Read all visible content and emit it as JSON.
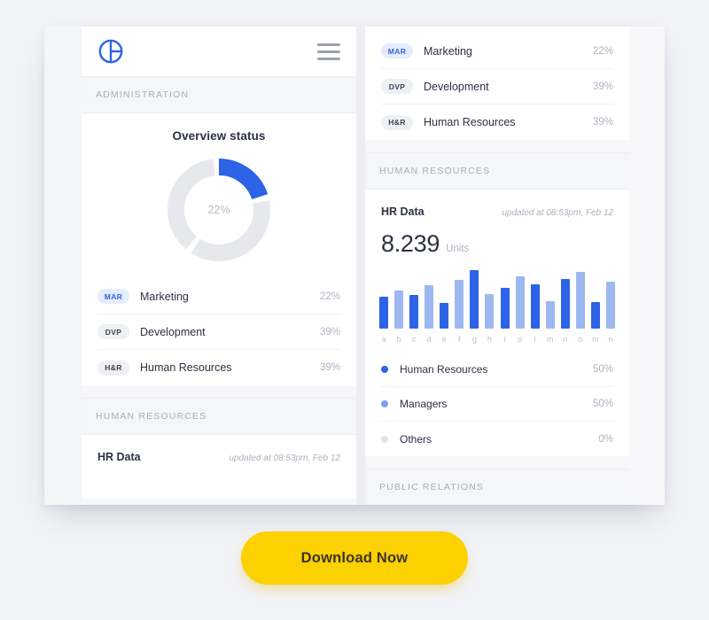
{
  "theme": {
    "page_background": "#f2f3f7",
    "card_background": "#ffffff",
    "band_background": "#f5f6f8",
    "accent_blue": "#2d63e6",
    "accent_blue_light": "#9db8f0",
    "muted_grey": "#e6e8ec",
    "cta_yellow": "#fdd000",
    "text_primary": "#2b3142",
    "text_muted": "#b0b4c0"
  },
  "appbar": {
    "logo_icon": "circle-quadrant-logo-icon",
    "menu_icon": "hamburger-menu-icon"
  },
  "left_panel": {
    "section_admin_label": "ADMINISTRATION",
    "overview": {
      "title": "Overview status",
      "center_value": "22%"
    },
    "departments": [
      {
        "code": "MAR",
        "label": "Marketing",
        "value": "22%",
        "badge_style": "accent"
      },
      {
        "code": "DVP",
        "label": "Development",
        "value": "39%",
        "badge_style": "mute"
      },
      {
        "code": "H&R",
        "label": "Human Resources",
        "value": "39%",
        "badge_style": "mute"
      }
    ],
    "section_hr_label": "HUMAN RESOURCES",
    "hr": {
      "title": "HR Data",
      "updated": "updated at 08:53pm, Feb 12"
    }
  },
  "right_panel": {
    "departments": [
      {
        "code": "MAR",
        "label": "Marketing",
        "value": "22%",
        "badge_style": "accent"
      },
      {
        "code": "DVP",
        "label": "Development",
        "value": "39%",
        "badge_style": "mute"
      },
      {
        "code": "H&R",
        "label": "Human Resources",
        "value": "39%",
        "badge_style": "mute"
      }
    ],
    "section_hr_label": "HUMAN RESOURCES",
    "hr": {
      "title": "HR Data",
      "updated": "updated at 08:53pm, Feb 12",
      "big_value": "8.239",
      "big_unit": "Units"
    },
    "legend": [
      {
        "label": "Human Resources",
        "value": "50%",
        "color": "#2d63e6"
      },
      {
        "label": "Managers",
        "value": "50%",
        "color": "#7f9fee"
      },
      {
        "label": "Others",
        "value": "0%",
        "color": "#dfe2e8"
      }
    ],
    "section_pr_label": "PUBLIC RELATIONS"
  },
  "cta": {
    "label": "Download Now"
  },
  "chart_data": [
    {
      "type": "pie",
      "title": "Overview status",
      "center_label": "22%",
      "legend_position": "below",
      "slices": [
        {
          "name": "Marketing",
          "value": 22,
          "color": "#2d63e6"
        },
        {
          "name": "Development",
          "value": 39,
          "color": "#e6e8ec"
        },
        {
          "name": "Human Resources",
          "value": 39,
          "color": "#e6e8ec"
        }
      ]
    },
    {
      "type": "bar",
      "title": "HR Data",
      "xlabel": "",
      "ylabel": "",
      "grid": false,
      "ylim": [
        0,
        100
      ],
      "categories": [
        "a",
        "b",
        "c",
        "d",
        "e",
        "f",
        "g",
        "h",
        "i",
        "o",
        "l",
        "m",
        "n",
        "o",
        "m",
        "n"
      ],
      "values": [
        52,
        62,
        54,
        70,
        42,
        78,
        95,
        56,
        66,
        84,
        72,
        44,
        80,
        92,
        43,
        76
      ],
      "bar_colors": [
        "#2d63e6",
        "#9db8f0",
        "#2d63e6",
        "#9db8f0",
        "#2d63e6",
        "#9db8f0",
        "#2d63e6",
        "#9db8f0",
        "#2d63e6",
        "#9db8f0",
        "#2d63e6",
        "#9db8f0",
        "#2d63e6",
        "#9db8f0",
        "#2d63e6",
        "#9db8f0"
      ],
      "summary_value": "8.239",
      "summary_unit": "Units",
      "legend": [
        {
          "name": "Human Resources",
          "value": 50,
          "color": "#2d63e6"
        },
        {
          "name": "Managers",
          "value": 50,
          "color": "#7f9fee"
        },
        {
          "name": "Others",
          "value": 0,
          "color": "#dfe2e8"
        }
      ]
    }
  ]
}
